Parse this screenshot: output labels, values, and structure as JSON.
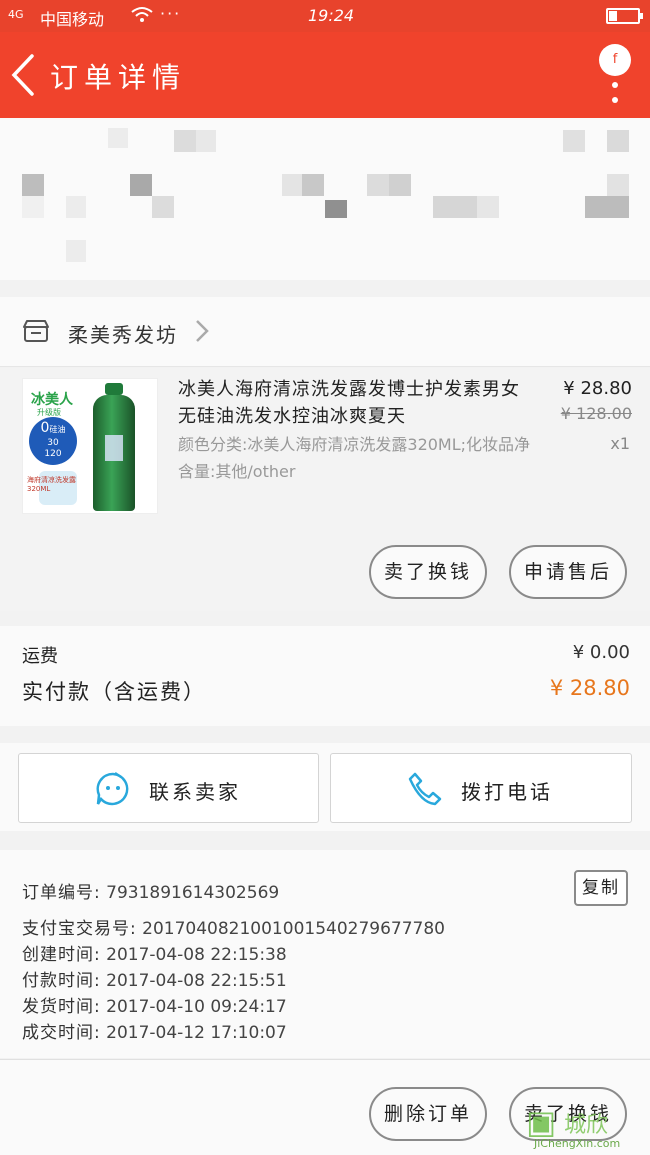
{
  "status_bar": {
    "signal": "4G",
    "carrier": "中国移动",
    "wifi": "᯼",
    "more": "···",
    "time": "19:24"
  },
  "nav": {
    "title": "订单详情",
    "more_badge": "f"
  },
  "shop": {
    "name": "柔美秀发坊"
  },
  "item": {
    "title": "冰美人海府清凉洗发露发博士护发素男女无硅油洗发水控油冰爽夏天",
    "sku": "颜色分类:冰美人海府清凉洗发露320ML;化妆品净含量:其他/other",
    "price": "¥ 28.80",
    "original_price": "¥ 128.00",
    "quantity": "x1",
    "thumb": {
      "brand": "冰美人",
      "sub": "升级版",
      "badge_big": "0",
      "badge_small1": "硅油",
      "badge_line2": "30",
      "badge_line3": "120",
      "caption": "海府清凉洗发露",
      "volume": "320ML"
    },
    "buttons": {
      "resell": "卖了换钱",
      "after_sale": "申请售后"
    }
  },
  "fees": {
    "shipping_label": "运费",
    "shipping_value": "¥ 0.00",
    "paid_label": "实付款（含运费）",
    "paid_value": "¥ 28.80"
  },
  "contact": {
    "seller": "联系卖家",
    "call": "拨打电话"
  },
  "order_info": {
    "order_no_label": "订单编号:",
    "order_no": "7931891614302569",
    "alipay_label": "支付宝交易号:",
    "alipay_no": "2017040821001001540279677780",
    "created_label": "创建时间:",
    "created": "2017-04-08  22:15:38",
    "paid_label": "付款时间:",
    "paid": "2017-04-08  22:15:51",
    "shipped_label": "发货时间:",
    "shipped": "2017-04-10 09:24:17",
    "completed_label": "成交时间:",
    "completed": "2017-04-12 17:10:07",
    "copy_label": "复制"
  },
  "bottom": {
    "delete": "删除订单",
    "resell": "卖了换钱"
  },
  "watermark": {
    "brand": "城欣",
    "url": "JiChengXin.com"
  },
  "colors": {
    "header": "#f0432c",
    "accent_price": "#e7761c"
  }
}
